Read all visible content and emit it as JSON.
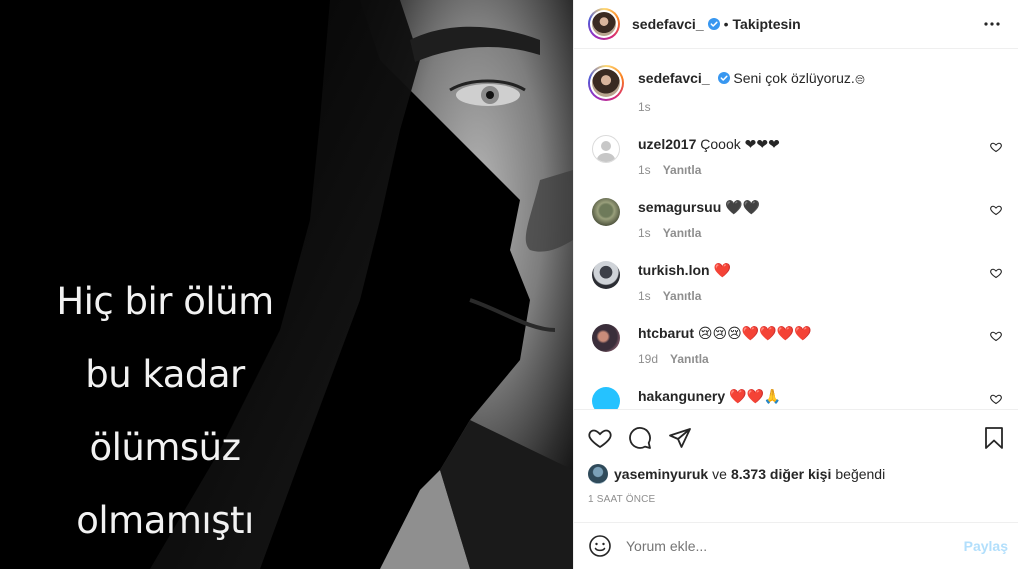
{
  "post": {
    "image": {
      "quote_lines": [
        "Hiç bir ölüm",
        "bu kadar",
        "ölümsüz",
        "olmamıştı"
      ]
    },
    "header": {
      "username": "sedefavci_",
      "separator": "•",
      "follow_state": "Takiptesin",
      "more_icon": "more-horizontal-icon"
    },
    "caption": {
      "username": "sedefavci_",
      "text": "Seni çok özlüyoruz.",
      "emoji": "😔",
      "time": "1s"
    },
    "comments": [
      {
        "username": "uzel2017",
        "text": "Çoook ❤❤❤",
        "time": "1s",
        "reply": "Yanıtla"
      },
      {
        "username": "semagursuu",
        "text": "🖤🖤",
        "time": "1s",
        "reply": "Yanıtla"
      },
      {
        "username": "turkish.lon",
        "text": "❤️",
        "time": "1s",
        "reply": "Yanıtla"
      },
      {
        "username": "htcbarut",
        "text": "😢😢😢❤️❤️❤️❤️",
        "time": "19d",
        "reply": "Yanıtla"
      },
      {
        "username": "hakangunery",
        "text": "❤️❤️🙏",
        "time": "",
        "reply": ""
      }
    ],
    "likes": {
      "first_user": "yaseminyuruk",
      "connector": "ve",
      "count_text": "8.373 diğer kişi",
      "suffix": "beğendi"
    },
    "time_ago": "1 SAAT ÖNCE",
    "comment_box": {
      "placeholder": "Yorum ekle...",
      "submit": "Paylaş"
    },
    "colors": {
      "link_disabled": "#b2dffc",
      "verified": "#3897f0",
      "meta": "#8e8e8e"
    }
  }
}
